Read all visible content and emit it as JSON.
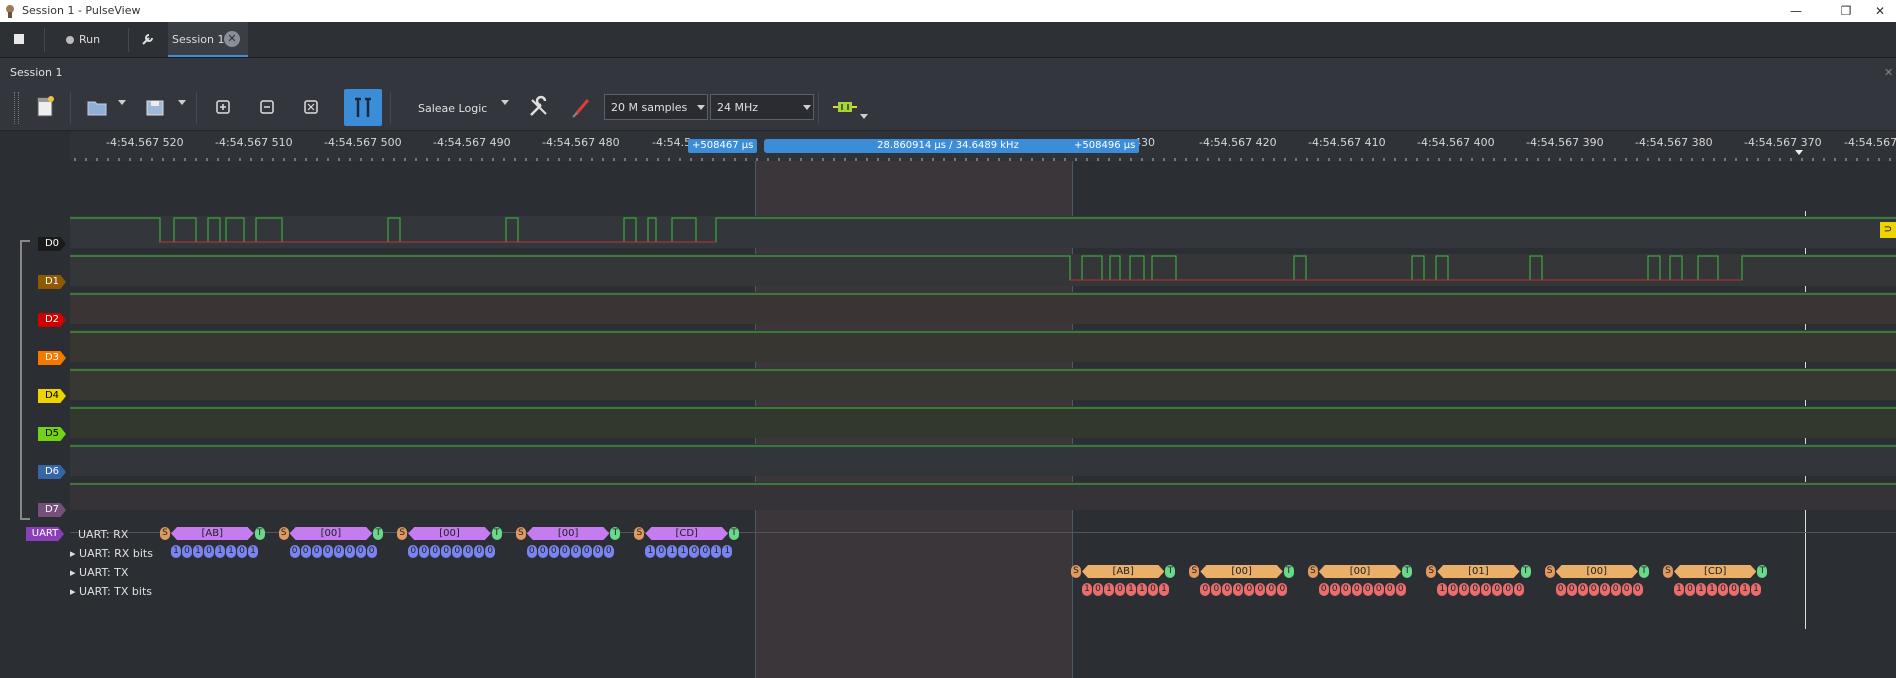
{
  "window": {
    "title": "Session 1 - PulseView",
    "min": "—",
    "max": "❐",
    "close": "✕"
  },
  "tabbar": {
    "run_label": "Run",
    "session_tab": "Session 1"
  },
  "session_header": {
    "title": "Session 1"
  },
  "toolbar": {
    "device": "Saleae Logic",
    "samples": "20 M samples",
    "samplerate": "24 MHz"
  },
  "ruler": {
    "ticks": [
      "-4:54.567 520",
      "-4:54.567 510",
      "-4:54.567 500",
      "-4:54.567 490",
      "-4:54.567 480",
      "-4:54.5",
      "430",
      "-4:54.567 420",
      "-4:54.567 410",
      "-4:54.567 400",
      "-4:54.567 390",
      "-4:54.567 380",
      "-4:54.567 370",
      "-4:54.567"
    ],
    "cursor_left": "+508467 µs",
    "cursor_mid": "28.860914 µs / 34.6489 kHz",
    "cursor_right": "+508496 µs"
  },
  "channels": [
    {
      "name": "D0",
      "color": "#1a1a1a",
      "text": "#ffffff"
    },
    {
      "name": "D1",
      "color": "#8f5902",
      "text": "#ffffff"
    },
    {
      "name": "D2",
      "color": "#cc0000",
      "text": "#ffffff"
    },
    {
      "name": "D3",
      "color": "#f57900",
      "text": "#ffffff"
    },
    {
      "name": "D4",
      "color": "#edd400",
      "text": "#000000"
    },
    {
      "name": "D5",
      "color": "#73d216",
      "text": "#000000"
    },
    {
      "name": "D6",
      "color": "#3465a4",
      "text": "#ffffff"
    },
    {
      "name": "D7",
      "color": "#75507b",
      "text": "#ffffff"
    }
  ],
  "decoder": {
    "badge": "UART",
    "rows": [
      "UART: RX",
      "UART: RX bits",
      "UART: TX",
      "UART: TX bits"
    ],
    "rx_bytes": [
      "[AB]",
      "[00]",
      "[00]",
      "[00]",
      "[CD]"
    ],
    "rx_bits": [
      "10101101",
      "00000000",
      "00000000",
      "00000000",
      "10110011"
    ],
    "tx_bytes": [
      "[AB]",
      "[00]",
      "[00]",
      "[01]",
      "[00]",
      "[CD]"
    ],
    "tx_bits": [
      "10101101",
      "00000000",
      "00000000",
      "10000000",
      "00000000",
      "10110011"
    ],
    "start_label": "S",
    "stop_label": "T"
  }
}
